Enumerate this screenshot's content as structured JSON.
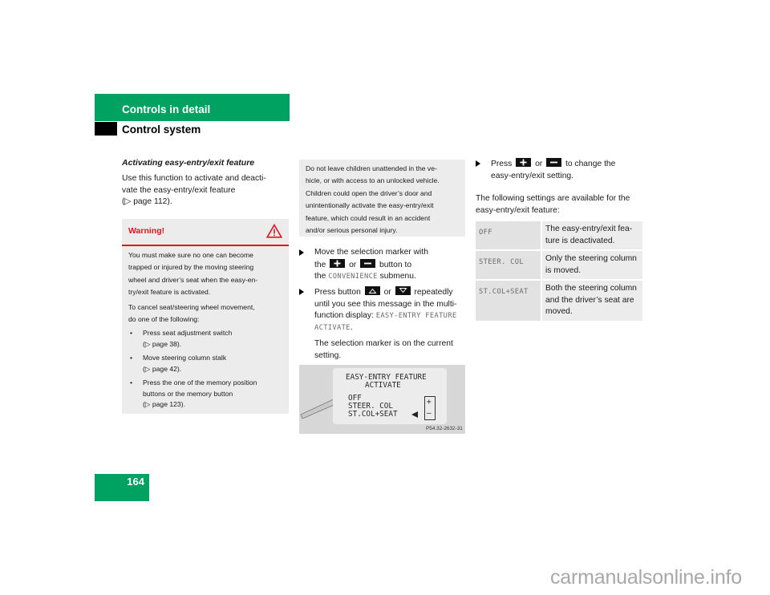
{
  "header": {
    "section_title": "Controls in detail",
    "subsection_title": "Control system",
    "accent_color": "#00a262"
  },
  "page_number": "164",
  "column1": {
    "heading": "Activating easy-entry/exit feature",
    "intro_lines": [
      "Use this function to activate and deacti-",
      "vate the easy-entry/exit feature",
      "(▷ page 112)."
    ],
    "warning": {
      "title": "Warning!",
      "icon": "warning-triangle-icon",
      "color": "#e0161e",
      "paragraph1_lines": [
        "You must make sure no one can become",
        "trapped or injured by the moving steering",
        "wheel and driver’s seat when the easy-en-",
        "try/exit feature is activated."
      ],
      "paragraph2_lines": [
        "To cancel seat/steering wheel movement,",
        "do one of the following:"
      ],
      "bullets": [
        {
          "lines": [
            "Press seat adjustment switch",
            "(▷ page 38)."
          ]
        },
        {
          "lines": [
            "Move steering column stalk",
            "(▷ page 42)."
          ]
        },
        {
          "lines": [
            "Press the one of the memory position",
            "buttons or the memory button",
            "(▷ page 123)."
          ]
        }
      ]
    }
  },
  "column2": {
    "warning_continued_lines": [
      "Do not leave children unattended in the ve-",
      "hicle, or with access to an unlocked vehicle.",
      "Children could open the driver’s door and",
      "unintentionally activate the easy-entry/exit",
      "feature, which could result in an accident",
      "and/or serious personal injury."
    ],
    "step1": {
      "a": "Move the selection marker with",
      "b_pre": "the",
      "b_or": "or",
      "b_post": "button to",
      "c_pre": "the",
      "c_mono": "CONVENIENCE",
      "c_post": "submenu."
    },
    "step2": {
      "a_pre": "Press button",
      "a_or": "or",
      "a_post": "repeatedly",
      "b": "until you see this message in the multi-",
      "c_pre": "function display:",
      "c_mono": "EASY-ENTRY FEATURE",
      "d_mono": "ACTIVATE",
      "d_post": "."
    },
    "step2_note_lines": [
      "The selection marker is on the current",
      "setting."
    ],
    "display": {
      "line1": "EASY-ENTRY FEATURE",
      "line2": "ACTIVATE",
      "options": [
        "OFF",
        "STEER. COL",
        "ST.COL+SEAT"
      ],
      "selected_option": "ST.COL+SEAT",
      "plus": "+",
      "minus": "–",
      "caption": "P54.32-2632-31"
    }
  },
  "column3": {
    "step": {
      "a_pre": "Press",
      "a_or": "or",
      "a_post": "to change the",
      "b": "easy-entry/exit setting."
    },
    "after_lines": [
      "The following settings are available for the",
      "easy-entry/exit feature:"
    ],
    "settings_table": [
      {
        "setting": "OFF",
        "description_lines": [
          "The easy-entry/exit fea-",
          "ture is deactivated."
        ]
      },
      {
        "setting": "STEER. COL",
        "description_lines": [
          "Only the steering column",
          "is moved."
        ]
      },
      {
        "setting": "ST.COL+SEAT",
        "description_lines": [
          "Both the steering column",
          "and the driver’s seat are",
          "moved."
        ]
      }
    ]
  },
  "watermark": "carmanualsonline.info"
}
